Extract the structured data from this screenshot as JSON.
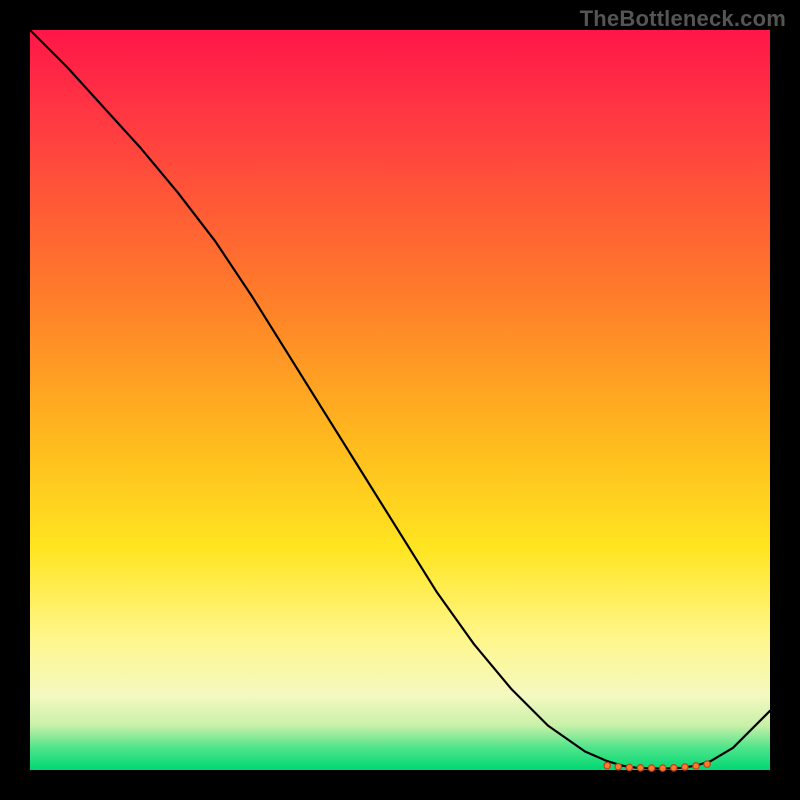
{
  "watermark": "TheBottleneck.com",
  "chart_data": {
    "type": "line",
    "title": "",
    "xlabel": "",
    "ylabel": "",
    "ylim": [
      0,
      100
    ],
    "xlim": [
      0,
      100
    ],
    "x": [
      0,
      5,
      10,
      15,
      20,
      25,
      30,
      35,
      40,
      45,
      50,
      55,
      60,
      65,
      70,
      75,
      78,
      80,
      82,
      84,
      86,
      88,
      90,
      92,
      95,
      100
    ],
    "values": [
      100,
      95,
      89.5,
      84,
      78,
      71.5,
      64,
      56,
      48,
      40,
      32,
      24,
      17,
      11,
      6,
      2.5,
      1.2,
      0.6,
      0.3,
      0.2,
      0.2,
      0.3,
      0.6,
      1.2,
      3,
      8
    ],
    "highlight_points_x": [
      78,
      79.5,
      81,
      82.5,
      84,
      85.5,
      87,
      88.5,
      90,
      91.5
    ],
    "highlight_points_y": [
      0.6,
      0.45,
      0.35,
      0.3,
      0.25,
      0.25,
      0.3,
      0.4,
      0.55,
      0.8
    ]
  }
}
